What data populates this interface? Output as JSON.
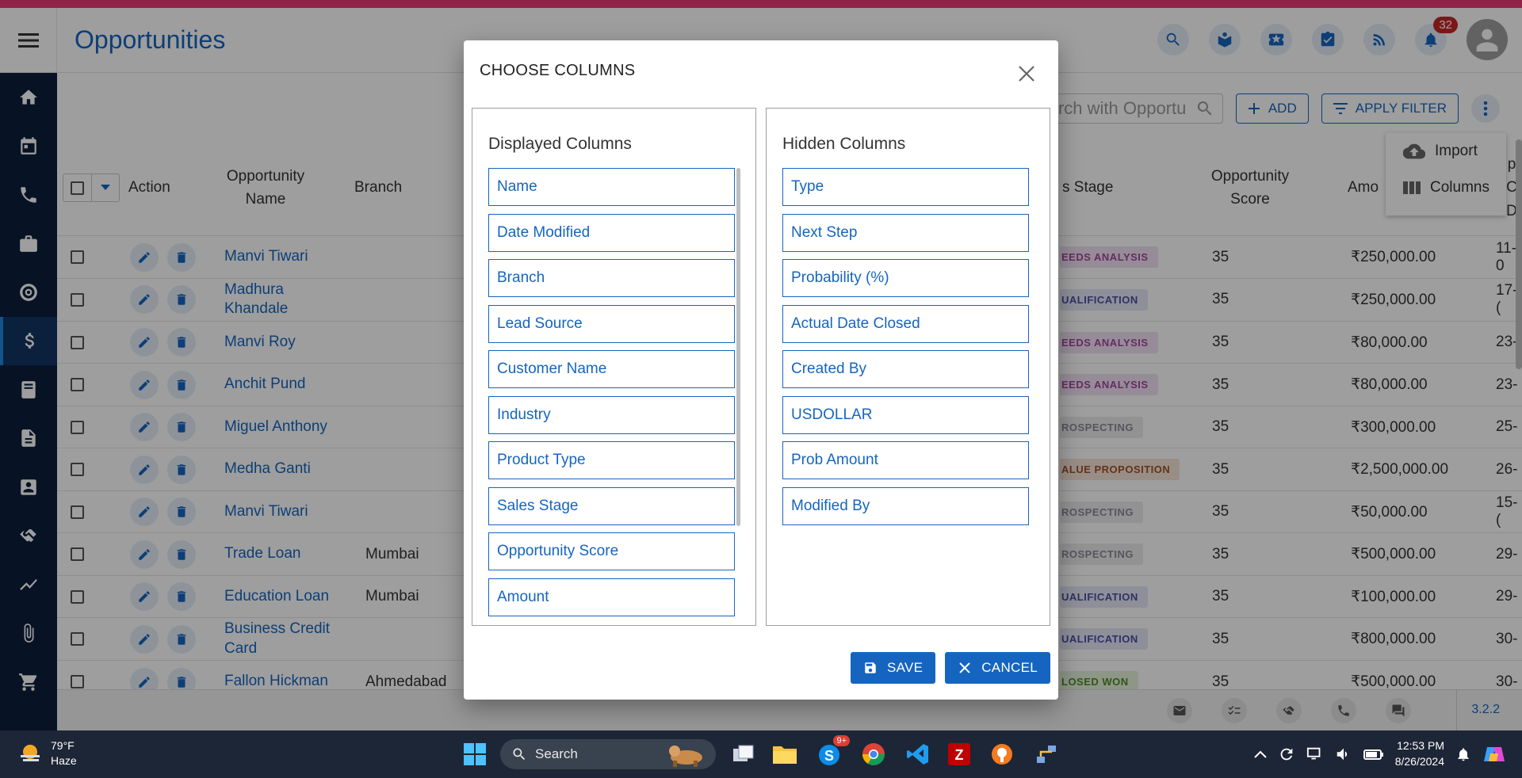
{
  "header": {
    "title": "Opportunities",
    "notification_count": "32"
  },
  "toolbar": {
    "search_placeholder": "Search with Opportunity Name",
    "add_label": "ADD",
    "filter_label": "APPLY FILTER"
  },
  "column_menu": {
    "import_label": "Import",
    "columns_label": "Columns"
  },
  "table": {
    "headers": {
      "action": "Action",
      "opportunity_name": "Opportunity Name",
      "branch": "Branch",
      "sales_stage": "s Stage",
      "opportunity_score": "Opportunity Score",
      "amount": "Amo",
      "extra": "p C D"
    },
    "rows": [
      {
        "name": "Manvi Tiwari",
        "branch": "",
        "stage": "EEDS ANALYSIS",
        "score": "35",
        "amount": "₹250,000.00",
        "date": "11-0"
      },
      {
        "name": "Madhura Khandale",
        "branch": "",
        "stage": "UALIFICATION",
        "score": "35",
        "amount": "₹250,000.00",
        "date": "17-("
      },
      {
        "name": "Manvi Roy",
        "branch": "",
        "stage": "EEDS ANALYSIS",
        "score": "35",
        "amount": "₹80,000.00",
        "date": "23-"
      },
      {
        "name": "Anchit Pund",
        "branch": "",
        "stage": "EEDS ANALYSIS",
        "score": "35",
        "amount": "₹80,000.00",
        "date": "23-"
      },
      {
        "name": "Miguel Anthony",
        "branch": "",
        "stage": "ROSPECTING",
        "score": "35",
        "amount": "₹300,000.00",
        "date": "25-"
      },
      {
        "name": "Medha Ganti",
        "branch": "",
        "stage": "ALUE PROPOSITION",
        "score": "35",
        "amount": "₹2,500,000.00",
        "date": "26-"
      },
      {
        "name": "Manvi Tiwari",
        "branch": "",
        "stage": "ROSPECTING",
        "score": "35",
        "amount": "₹50,000.00",
        "date": "15-("
      },
      {
        "name": "Trade Loan",
        "branch": "Mumbai",
        "stage": "ROSPECTING",
        "score": "35",
        "amount": "₹500,000.00",
        "date": "29-"
      },
      {
        "name": "Education Loan",
        "branch": "Mumbai",
        "stage": "UALIFICATION",
        "score": "35",
        "amount": "₹100,000.00",
        "date": "29-"
      },
      {
        "name": "Business Credit Card",
        "branch": "",
        "stage": "UALIFICATION",
        "score": "35",
        "amount": "₹800,000.00",
        "date": "30-"
      },
      {
        "name": "Fallon Hickman",
        "branch": "Ahmedabad",
        "stage": "LOSED WON",
        "score": "35",
        "amount": "₹500,000.00",
        "date": "30-"
      }
    ]
  },
  "stage_colors": {
    "EEDS ANALYSIS": {
      "bg": "#f3e3f5",
      "fg": "#a4479e"
    },
    "UALIFICATION": {
      "bg": "#e6e7f7",
      "fg": "#4b4fa3"
    },
    "ROSPECTING": {
      "bg": "#ececec",
      "fg": "#8a8a9a"
    },
    "ALUE PROPOSITION": {
      "bg": "#f7e6d9",
      "fg": "#a0522d"
    },
    "LOSED WON": {
      "bg": "#e6f3dc",
      "fg": "#4f8a2b"
    }
  },
  "modal": {
    "title": "CHOOSE COLUMNS",
    "displayed_title": "Displayed Columns",
    "hidden_title": "Hidden Columns",
    "displayed_columns": [
      "Name",
      "Date Modified",
      "Branch",
      "Lead Source",
      "Customer Name",
      "Industry",
      "Product Type",
      "Sales Stage",
      "Opportunity Score",
      "Amount"
    ],
    "hidden_columns": [
      "Type",
      "Next Step",
      "Probability (%)",
      "Actual Date Closed",
      "Created By",
      "USDOLLAR",
      "Prob Amount",
      "Modified By"
    ],
    "save_label": "SAVE",
    "cancel_label": "CANCEL"
  },
  "footer": {
    "version": "3.2.2"
  },
  "taskbar": {
    "temperature": "79°F",
    "weather": "Haze",
    "search_label": "Search",
    "skype_badge": "9+",
    "time": "12:53 PM",
    "date": "8/26/2024"
  },
  "colors": {
    "accent": "#e53b75",
    "primary": "#1565c0",
    "sidebar": "#0c1f3c",
    "taskbar": "#1d2636"
  }
}
